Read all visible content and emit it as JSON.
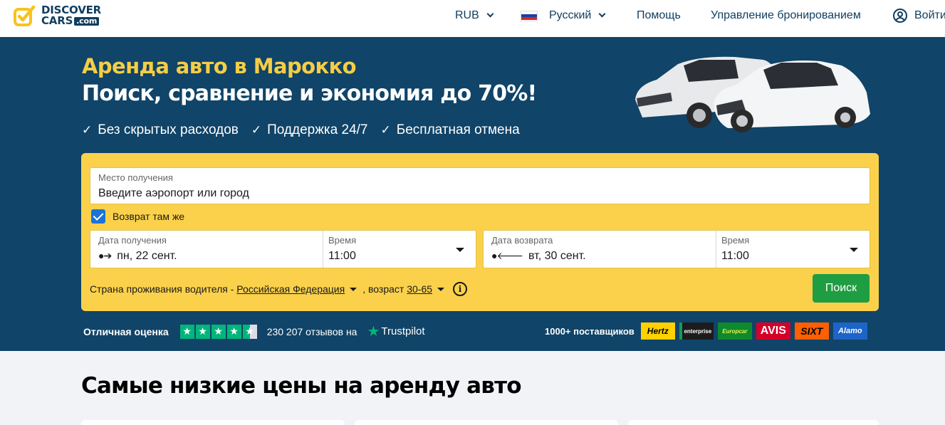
{
  "header": {
    "logo": {
      "line1": "DISCOVER",
      "line2": "CARS",
      "suffix": ".com"
    },
    "currency": "RUB",
    "language": "Русский",
    "help": "Помощь",
    "manage_booking": "Управление бронированием",
    "login": "Войти"
  },
  "hero": {
    "title": "Аренда авто в Марокко",
    "subtitle": "Поиск, сравнение и экономия до 70%!",
    "benefits": [
      "Без скрытых расходов",
      "Поддержка 24/7",
      "Бесплатная отмена"
    ]
  },
  "search": {
    "pickup_label": "Место получения",
    "pickup_placeholder": "Введите аэропорт или город",
    "same_return_label": "Возврат там же",
    "same_return_checked": true,
    "pickup_date_label": "Дата получения",
    "pickup_date": "пн, 22 сент.",
    "pickup_time_label": "Время",
    "pickup_time": "11:00",
    "return_date_label": "Дата возврата",
    "return_date": "вт, 30 сент.",
    "return_time_label": "Время",
    "return_time": "11:00",
    "residence_prefix": "Страна проживания водителя -",
    "residence_country": "Российская Федерация",
    "age_prefix": ", возраст",
    "age_range": "30-65",
    "info_glyph": "i",
    "search_button": "Поиск"
  },
  "rating": {
    "label": "Отличная оценка",
    "stars": 4.5,
    "reviews_text": "230 207 отзывов на",
    "platform": "Trustpilot"
  },
  "suppliers": {
    "label": "1000+ поставщиков",
    "brands": [
      "Hertz",
      "enterprise",
      "Europcar",
      "AVIS",
      "SIXT",
      "Alamo"
    ]
  },
  "lower": {
    "section_title": "Самые низкие цены на аренду авто"
  },
  "colors": {
    "navy": "#104468",
    "yellow": "#fbd14b",
    "title_yellow": "#f6cd44",
    "green_button": "#1f9d42",
    "checkbox_blue": "#1a73d9",
    "trustpilot_green": "#00b67a"
  },
  "icons": {
    "logo": "checkbox-logo-icon",
    "chevron": "chevron-down-icon",
    "flag": "russia-flag-icon",
    "user": "user-icon",
    "check": "check-icon",
    "pickup_date": "arrow-right-dot-icon",
    "return_date": "arrow-left-dot-icon",
    "dropdown": "caret-down-icon",
    "info": "info-icon",
    "star": "star-icon"
  }
}
